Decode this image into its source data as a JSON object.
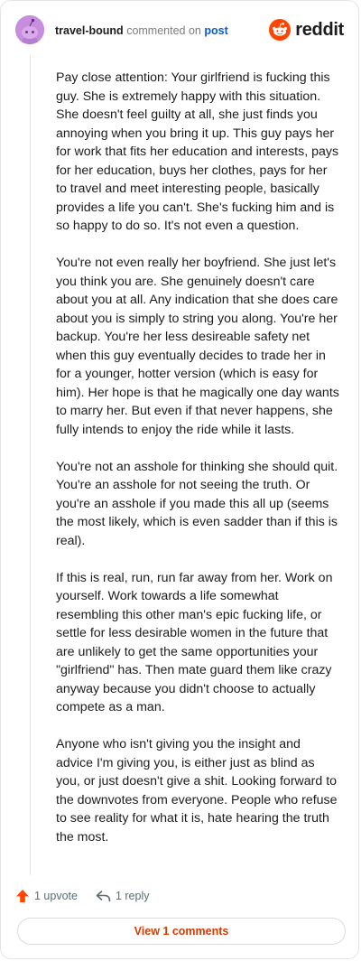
{
  "header": {
    "username": "travel-bound",
    "verb": "commented on",
    "post_link": "post",
    "logo_text": "reddit",
    "avatar_icon": "snoo-avatar-icon",
    "logo_icon": "reddit-snoo-icon"
  },
  "comment": {
    "paragraphs": [
      "Pay close attention: Your girlfriend is fucking this guy. She is extremely happy with this situation. She doesn't feel guilty at all, she just finds you annoying when you bring it up. This guy pays her for work that fits her education and interests, pays for her education, buys her clothes, pays for her to travel and meet interesting people, basically provides a life you can't. She's fucking him and is so happy to do so. It's not even a question.",
      "You're not even really her boyfriend. She just let's you think you are. She genuinely doesn't care about you at all. Any indication that she does care about you is simply to string you along. You're her backup. You're her less desireable safety net when this guy eventually decides to trade her in for a younger, hotter version (which is easy for him). Her hope is that he magically one day wants to marry her. But even if that never happens, she fully intends to enjoy the ride while it lasts.",
      "You're not an asshole for thinking she should quit. You're an asshole for not seeing the truth. Or you're an asshole if you made this all up (seems the most likely, which is even sadder than if this is real).",
      "If this is real, run, run far away from her. Work on yourself. Work towards a life somewhat resembling this other man's epic fucking life, or settle for less desirable women in the future that are unlikely to get the same opportunities your \"girlfriend\" has. Then mate guard them like crazy anyway because you didn't choose to actually compete as a man.",
      "Anyone who isn't giving you the insight and advice I'm giving you, is either just as blind as you, or just doesn't give a shit. Looking forward to the downvotes from everyone. People who refuse to see reality for what it is, hate hearing the truth the most."
    ]
  },
  "actions": {
    "upvote_label": "1 upvote",
    "reply_label": "1 reply",
    "upvote_icon": "upvote-arrow-icon",
    "reply_icon": "reply-arrow-icon",
    "upvote_color": "#ff4500"
  },
  "footer": {
    "view_comments_label": "View 1 comments"
  },
  "colors": {
    "brand": "#ff4500",
    "link": "#0a5bd6",
    "view_button_text": "#d93a00",
    "avatar_bg": "#c78ee0"
  }
}
